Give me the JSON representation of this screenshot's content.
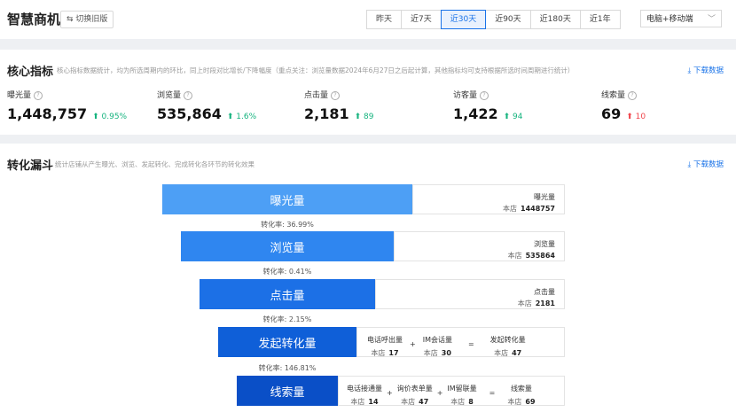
{
  "header": {
    "app_title": "智慧商机",
    "switch_label": "⇆ 切换旧版",
    "ranges": [
      "昨天",
      "近7天",
      "近30天",
      "近90天",
      "近180天",
      "近1年"
    ],
    "active_range": "近30天",
    "device_select": "电脑+移动端"
  },
  "core": {
    "title": "核心指标",
    "desc": "核心指标数据统计，均为所选周期内的环比，同上时段对比增长/下降幅度（重点关注：浏览量数据2024年6月27日之后起计算，其他指标均可支持根据所选时间周期进行统计）",
    "download": "下载数据",
    "metrics": [
      {
        "label": "曝光量",
        "value": "1,448,757",
        "change": "0.95%",
        "direction": "up",
        "color": "#15b37e"
      },
      {
        "label": "浏览量",
        "value": "535,864",
        "change": "1.6%",
        "direction": "up",
        "color": "#15b37e"
      },
      {
        "label": "点击量",
        "value": "2,181",
        "change": "89",
        "direction": "up",
        "color": "#15b37e"
      },
      {
        "label": "访客量",
        "value": "1,422",
        "change": "94",
        "direction": "up",
        "color": "#15b37e"
      },
      {
        "label": "线索量",
        "value": "69",
        "change": "10",
        "direction": "up",
        "color": "#f0444b"
      }
    ]
  },
  "funnel": {
    "title": "转化漏斗",
    "desc": "统计店铺从产生曝光、浏览、发起转化、完成转化各环节的转化效果",
    "download": "下载数据",
    "stages": [
      {
        "label": "曝光量",
        "color": "#4d9ff5",
        "box_label": "曝光量",
        "store_prefix": "本店",
        "store_value": "1448757"
      },
      {
        "label": "浏览量",
        "color": "#2f86f0",
        "box_label": "浏览量",
        "store_prefix": "本店",
        "store_value": "535864"
      },
      {
        "label": "点击量",
        "color": "#1c70e6",
        "box_label": "点击量",
        "store_prefix": "本店",
        "store_value": "2181"
      },
      {
        "label": "发起转化量",
        "color": "#0f5fd8",
        "store_prefix": "本店"
      },
      {
        "label": "线索量",
        "color": "#0a4fc7",
        "store_prefix": "本店"
      }
    ],
    "conversions": [
      "转化率: 36.99%",
      "转化率: 0.41%",
      "转化率: 2.15%",
      "转化率: 146.81%"
    ],
    "initiate_formula": {
      "a_label": "电话呼出量",
      "a_value": "17",
      "b_label": "IM会话量",
      "b_value": "30",
      "r_label": "发起转化量",
      "r_value": "47"
    },
    "lead_formula": {
      "a_label": "电话接通量",
      "a_value": "14",
      "b_label": "询价表单量",
      "b_value": "47",
      "c_label": "IM留联量",
      "c_value": "8",
      "r_label": "线索量",
      "r_value": "69"
    },
    "ops": {
      "plus": "+",
      "equals": "="
    }
  }
}
